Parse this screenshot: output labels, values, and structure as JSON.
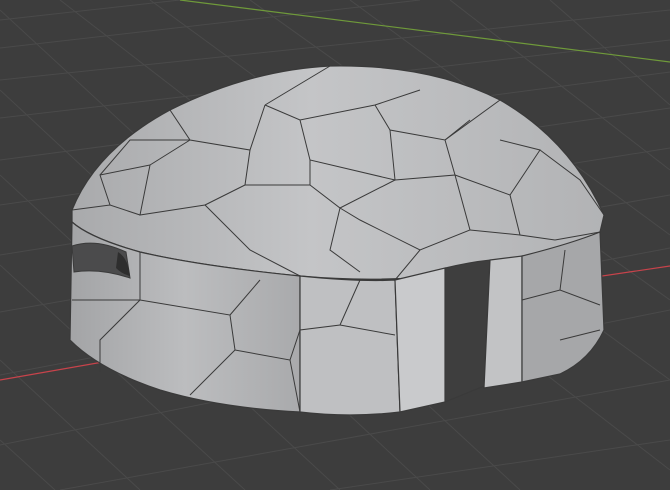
{
  "viewport": {
    "background_color": "#3d3d3d",
    "grid_color": "#4a4a4a",
    "x_axis_color": "#c8434b",
    "y_axis_color": "#6f9a3a",
    "mesh_object": "dome-igloo-with-doorway",
    "mesh_face_color": "#b8b9bb",
    "mesh_edge_color": "#3a3a3a",
    "shading_mode": "solid",
    "overlay_wireframe": true
  }
}
